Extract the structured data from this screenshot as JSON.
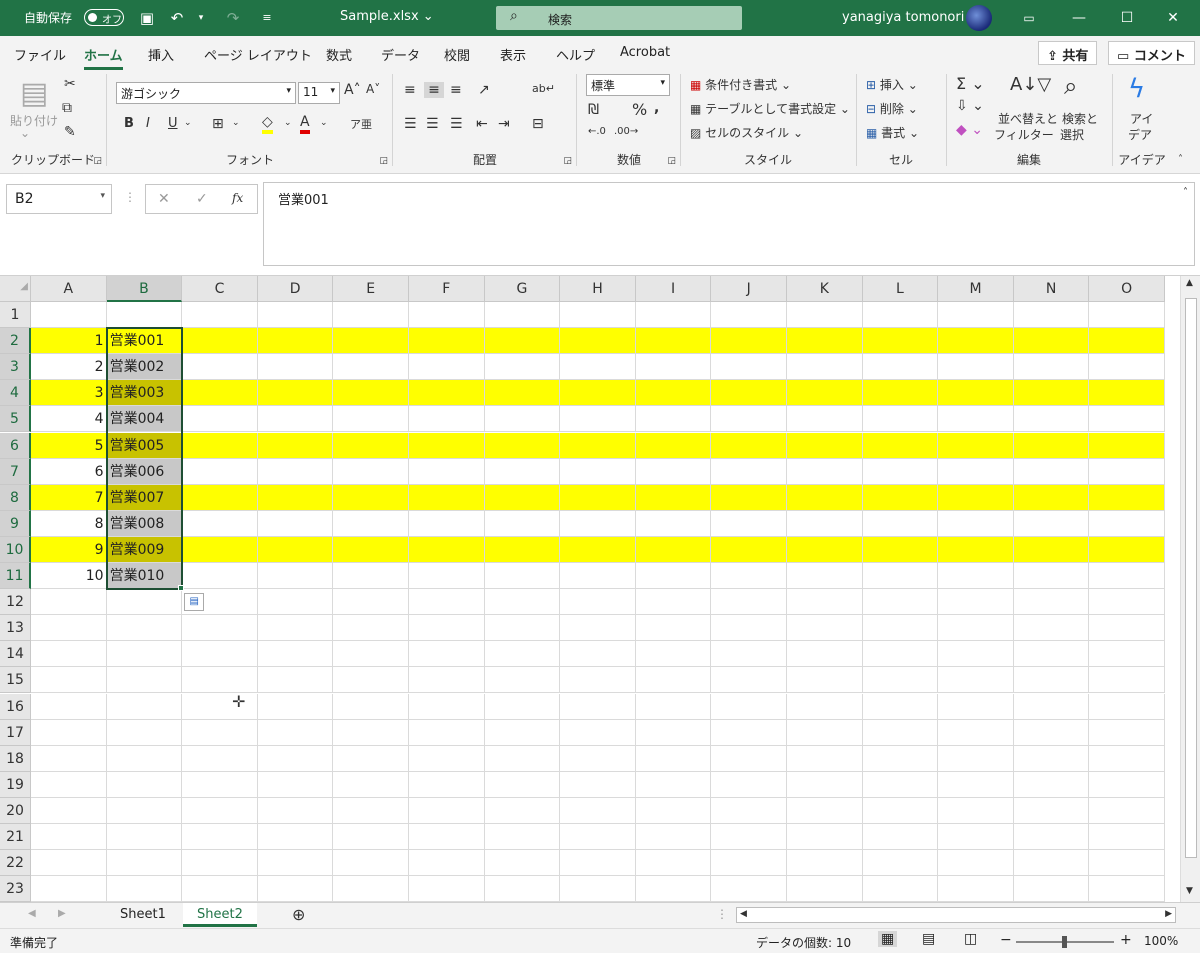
{
  "title": {
    "autosave": "自動保存",
    "toggle": "オフ",
    "filename": "Sample.xlsx",
    "search": "検索",
    "user": "yanagiya tomonori"
  },
  "tabs": [
    "ファイル",
    "ホーム",
    "挿入",
    "ページ レイアウト",
    "数式",
    "データ",
    "校閲",
    "表示",
    "ヘルプ",
    "Acrobat"
  ],
  "share": "共有",
  "comment": "コメント",
  "ribbon": {
    "paste": "貼り付け",
    "clipboard": "クリップボード",
    "font_name": "游ゴシック",
    "font_size": "11",
    "font_group": "フォント",
    "align_group": "配置",
    "number_format": "標準",
    "number_group": "数値",
    "cond_format": "条件付き書式",
    "table_format": "テーブルとして書式設定",
    "cell_style": "セルのスタイル",
    "style_group": "スタイル",
    "insert": "挿入",
    "delete": "削除",
    "format": "書式",
    "cells_group": "セル",
    "sort_filter_1": "並べ替えと",
    "sort_filter_2": "フィルター",
    "find_select_1": "検索と",
    "find_select_2": "選択",
    "edit_group": "編集",
    "ideas_1": "アイ",
    "ideas_2": "デア",
    "ideas_group": "アイデア"
  },
  "formula_bar": {
    "name_box": "B2",
    "fx": "fx",
    "content": "営業001"
  },
  "columns": [
    "A",
    "B",
    "C",
    "D",
    "E",
    "F",
    "G",
    "H",
    "I",
    "J",
    "K",
    "L",
    "M",
    "N",
    "O"
  ],
  "rows": [
    "1",
    "2",
    "3",
    "4",
    "5",
    "6",
    "7",
    "8",
    "9",
    "10",
    "11",
    "12",
    "13",
    "14",
    "15",
    "16",
    "17",
    "18",
    "19",
    "20",
    "21",
    "22",
    "23"
  ],
  "cells": {
    "A": [
      "",
      "1",
      "2",
      "3",
      "4",
      "5",
      "6",
      "7",
      "8",
      "9",
      "10"
    ],
    "B": [
      "",
      "営業001",
      "営業002",
      "営業003",
      "営業004",
      "営業005",
      "営業006",
      "営業007",
      "営業008",
      "営業009",
      "営業010"
    ]
  },
  "sheets": [
    "Sheet1",
    "Sheet2"
  ],
  "status": {
    "ready": "準備完了",
    "count_label": "データの個数: 10",
    "zoom": "100%"
  },
  "colors": {
    "brand": "#217346",
    "highlight": "#FFFF00"
  }
}
